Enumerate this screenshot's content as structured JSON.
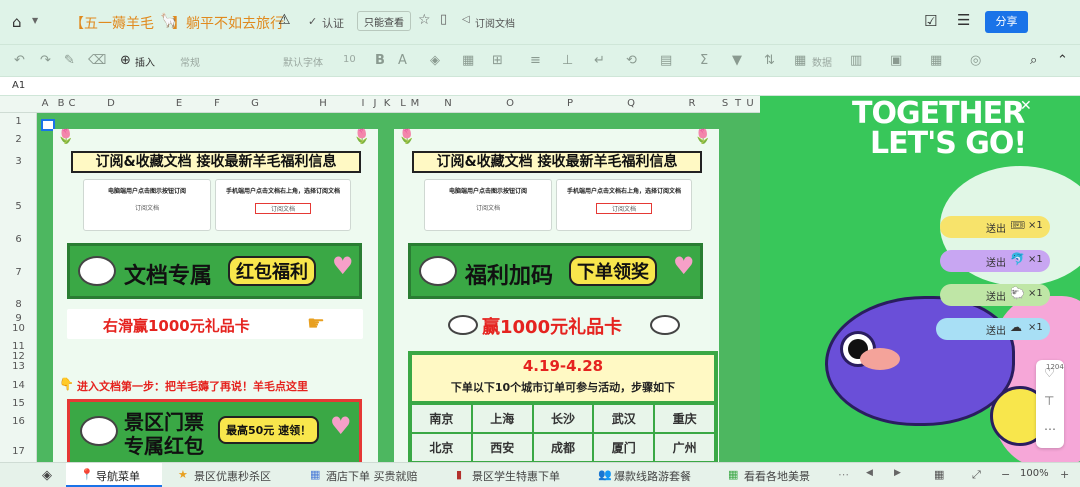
{
  "title": {
    "prefix": "【五一薅羊毛",
    "suffix": "】躺平不如去旅行",
    "certified": "认证",
    "view_only": "只能查看",
    "subscribe": "订阅文档",
    "share": "分享"
  },
  "toolbar": {
    "insert": "插入",
    "format": "常规",
    "font": "默认字体",
    "size": "10",
    "data": "数据"
  },
  "formula": {
    "cell": "A1"
  },
  "columns": [
    "A",
    "B",
    "C",
    "D",
    "E",
    "F",
    "G",
    "H",
    "I",
    "J",
    "K",
    "L",
    "M",
    "N",
    "O",
    "P",
    "Q",
    "R",
    "S",
    "T",
    "U"
  ],
  "rows": [
    "1",
    "2",
    "3",
    "5",
    "6",
    "7",
    "8",
    "9",
    "10",
    "11",
    "12",
    "13",
    "14",
    "15",
    "16",
    "17"
  ],
  "left_panel": {
    "header": "订阅&收藏文档 接收最新羊毛福利信息",
    "pc_tip": "电脑端用户点击图示按钮订阅",
    "pc_sub": "订阅文档",
    "mobile_tip": "手机端用户点击文档右上角，选择订阅文档",
    "mobile_sub": "订阅文档",
    "banner_left": "文档专属",
    "banner_pill": "红包福利",
    "swipe": "右滑赢1000元礼品卡",
    "step": "进入文档第一步：把羊毛薅了再说！羊毛点这里",
    "bottom_l1": "景区门票",
    "bottom_l2": "专属红包",
    "bottom_pill": "最高50元 速领！"
  },
  "right_panel": {
    "header": "订阅&收藏文档 接收最新羊毛福利信息",
    "pc_tip": "电脑端用户点击图示按钮订阅",
    "pc_sub": "订阅文档",
    "mobile_tip": "手机端用户点击文档右上角，选择订阅文档",
    "mobile_sub": "订阅文档",
    "banner_left": "福利加码",
    "banner_pill": "下单领奖",
    "prize": "赢1000元礼品卡",
    "dates": "4.19-4.28",
    "cities_tip": "下单以下10个城市订单可参与活动，步骤如下",
    "cities": [
      "南京",
      "上海",
      "长沙",
      "武汉",
      "重庆",
      "北京",
      "西安",
      "成都",
      "厦门",
      "广州"
    ]
  },
  "promo": {
    "line1": "TOGETHER",
    "line2": "LET'S GO!",
    "gifts": [
      {
        "label": "送出",
        "count": "×1"
      },
      {
        "label": "送出",
        "count": "×1"
      },
      {
        "label": "送出",
        "count": "×1"
      },
      {
        "label": "送出",
        "count": "×1"
      }
    ],
    "likes": "1204"
  },
  "tabs": [
    "导航菜单",
    "景区优惠秒杀区",
    "酒店下单 买贵就赔",
    "景区学生特惠下单",
    "爆款线路游套餐",
    "看看各地美景"
  ],
  "zoom": "100%"
}
